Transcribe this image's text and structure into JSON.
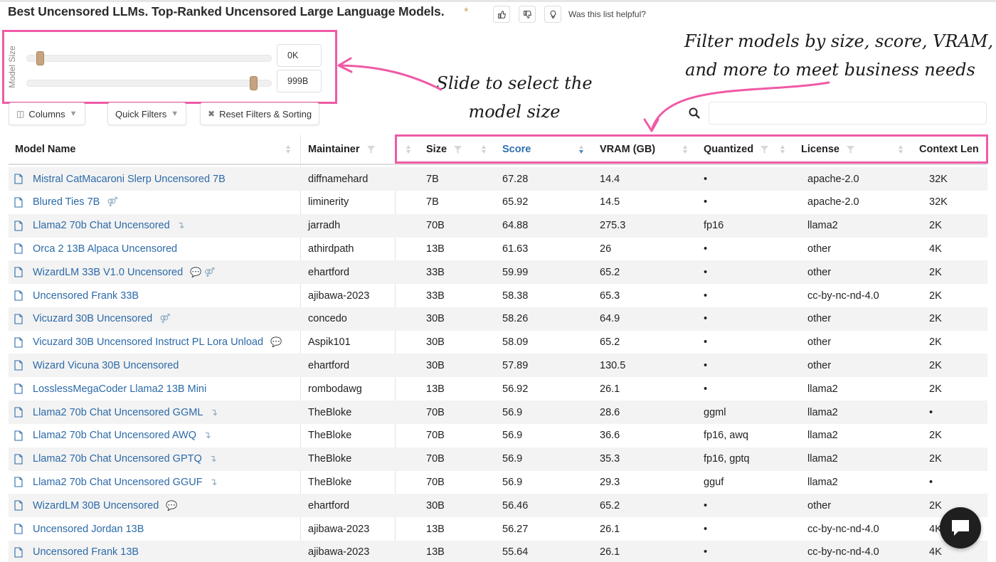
{
  "page": {
    "title": "Best Uncensored LLMs. Top-Ranked Uncensored Large Language Models.",
    "star": "*",
    "helpful_text": "Was this list helpful?"
  },
  "slider": {
    "label": "Model Size",
    "min_value": "0K",
    "max_value": "999B",
    "min_fraction": 0.0,
    "max_fraction": 1.0
  },
  "toolbar": {
    "columns_label": "Columns",
    "quick_filters_label": "Quick Filters",
    "reset_label": "Reset Filters & Sorting",
    "search_value": ""
  },
  "annotations": {
    "slider_note_line1": "Slide to select the",
    "slider_note_line2": "model size",
    "filter_note_line1": "Filter models by size, score, VRAM,",
    "filter_note_line2": "and more to meet business needs",
    "highlight_color": "#ef5aa6"
  },
  "table": {
    "headers": [
      "Model Name",
      "Maintainer",
      "Size",
      "Score",
      "VRAM (GB)",
      "Quantized",
      "License",
      "Context Len"
    ],
    "sorted_column": "Score",
    "rows": [
      {
        "name": "Mistral CatMacaroni Slerp Uncensored 7B",
        "icons": "",
        "maintainer": "diffnamehard",
        "size": "7B",
        "score": "67.28",
        "vram": "14.4",
        "quantized": "•",
        "license": "apache-2.0",
        "context": "32K"
      },
      {
        "name": "Blured Ties 7B",
        "icons": "⚤",
        "maintainer": "liminerity",
        "size": "7B",
        "score": "65.92",
        "vram": "14.5",
        "quantized": "•",
        "license": "apache-2.0",
        "context": "32K"
      },
      {
        "name": "Llama2 70b Chat Uncensored",
        "icons": "↴",
        "maintainer": "jarradh",
        "size": "70B",
        "score": "64.88",
        "vram": "275.3",
        "quantized": "fp16",
        "license": "llama2",
        "context": "2K"
      },
      {
        "name": "Orca 2 13B Alpaca Uncensored",
        "icons": "",
        "maintainer": "athirdpath",
        "size": "13B",
        "score": "61.63",
        "vram": "26",
        "quantized": "•",
        "license": "other",
        "context": "4K"
      },
      {
        "name": "WizardLM 33B V1.0 Uncensored",
        "icons": "💬 ⚤",
        "maintainer": "ehartford",
        "size": "33B",
        "score": "59.99",
        "vram": "65.2",
        "quantized": "•",
        "license": "other",
        "context": "2K"
      },
      {
        "name": "Uncensored Frank 33B",
        "icons": "",
        "maintainer": "ajibawa-2023",
        "size": "33B",
        "score": "58.38",
        "vram": "65.3",
        "quantized": "•",
        "license": "cc-by-nc-nd-4.0",
        "context": "2K"
      },
      {
        "name": "Vicuzard 30B Uncensored",
        "icons": "⚤",
        "maintainer": "concedo",
        "size": "30B",
        "score": "58.26",
        "vram": "64.9",
        "quantized": "•",
        "license": "other",
        "context": "2K"
      },
      {
        "name": "Vicuzard 30B Uncensored Instruct PL Lora Unload",
        "icons": "💬",
        "maintainer": "Aspik101",
        "size": "30B",
        "score": "58.09",
        "vram": "65.2",
        "quantized": "•",
        "license": "other",
        "context": "2K"
      },
      {
        "name": "Wizard Vicuna 30B Uncensored",
        "icons": "",
        "maintainer": "ehartford",
        "size": "30B",
        "score": "57.89",
        "vram": "130.5",
        "quantized": "•",
        "license": "other",
        "context": "2K"
      },
      {
        "name": "LosslessMegaCoder Llama2 13B Mini",
        "icons": "",
        "maintainer": "rombodawg",
        "size": "13B",
        "score": "56.92",
        "vram": "26.1",
        "quantized": "•",
        "license": "llama2",
        "context": "2K"
      },
      {
        "name": "Llama2 70b Chat Uncensored GGML",
        "icons": "↴",
        "maintainer": "TheBloke",
        "size": "70B",
        "score": "56.9",
        "vram": "28.6",
        "quantized": "ggml",
        "license": "llama2",
        "context": "•"
      },
      {
        "name": "Llama2 70b Chat Uncensored AWQ",
        "icons": "↴",
        "maintainer": "TheBloke",
        "size": "70B",
        "score": "56.9",
        "vram": "36.6",
        "quantized": "fp16, awq",
        "license": "llama2",
        "context": "2K"
      },
      {
        "name": "Llama2 70b Chat Uncensored GPTQ",
        "icons": "↴",
        "maintainer": "TheBloke",
        "size": "70B",
        "score": "56.9",
        "vram": "35.3",
        "quantized": "fp16, gptq",
        "license": "llama2",
        "context": "2K"
      },
      {
        "name": "Llama2 70b Chat Uncensored GGUF",
        "icons": "↴",
        "maintainer": "TheBloke",
        "size": "70B",
        "score": "56.9",
        "vram": "29.3",
        "quantized": "gguf",
        "license": "llama2",
        "context": "•"
      },
      {
        "name": "WizardLM 30B Uncensored",
        "icons": "💬",
        "maintainer": "ehartford",
        "size": "30B",
        "score": "56.46",
        "vram": "65.2",
        "quantized": "•",
        "license": "other",
        "context": "2K"
      },
      {
        "name": "Uncensored Jordan 13B",
        "icons": "",
        "maintainer": "ajibawa-2023",
        "size": "13B",
        "score": "56.27",
        "vram": "26.1",
        "quantized": "•",
        "license": "cc-by-nc-nd-4.0",
        "context": "4K"
      },
      {
        "name": "Uncensored Frank 13B",
        "icons": "",
        "maintainer": "ajibawa-2023",
        "size": "13B",
        "score": "55.64",
        "vram": "26.1",
        "quantized": "•",
        "license": "cc-by-nc-nd-4.0",
        "context": "4K"
      }
    ]
  }
}
